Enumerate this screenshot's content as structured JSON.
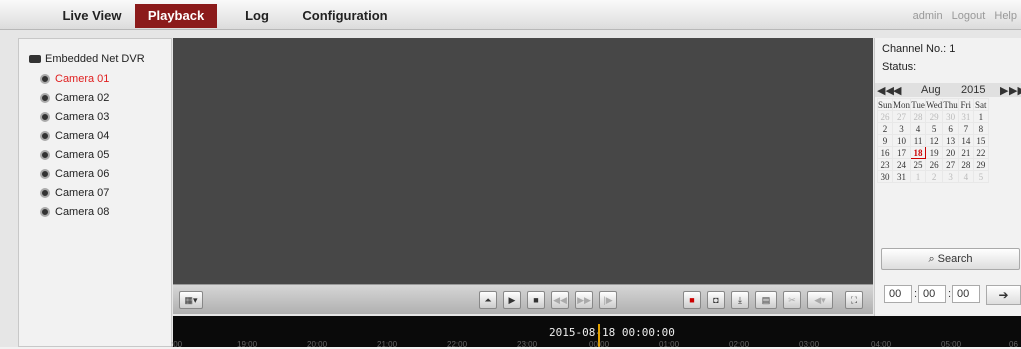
{
  "nav": {
    "tabs": [
      "Live View",
      "Playback",
      "Log",
      "Configuration"
    ],
    "active": "Playback"
  },
  "user": {
    "name": "admin",
    "logout": "Logout",
    "help": "Help"
  },
  "tree": {
    "root": "Embedded Net DVR",
    "cameras": [
      "Camera 01",
      "Camera 02",
      "Camera 03",
      "Camera 04",
      "Camera 05",
      "Camera 06",
      "Camera 07",
      "Camera 08"
    ],
    "selected": "Camera 01"
  },
  "info": {
    "channel_label": "Channel No.: 1",
    "status_label": "Status:"
  },
  "calendar": {
    "month": "Aug",
    "year": "2015",
    "weekdays": [
      "Sun",
      "Mon",
      "Tue",
      "Wed",
      "Thu",
      "Fri",
      "Sat"
    ],
    "weeks": [
      [
        "26",
        "27",
        "28",
        "29",
        "30",
        "31",
        "1"
      ],
      [
        "2",
        "3",
        "4",
        "5",
        "6",
        "7",
        "8"
      ],
      [
        "9",
        "10",
        "11",
        "12",
        "13",
        "14",
        "15"
      ],
      [
        "16",
        "17",
        "18",
        "19",
        "20",
        "21",
        "22"
      ],
      [
        "23",
        "24",
        "25",
        "26",
        "27",
        "28",
        "29"
      ],
      [
        "30",
        "31",
        "1",
        "2",
        "3",
        "4",
        "5"
      ]
    ],
    "today": "18"
  },
  "search_label": "Search",
  "time_fields": {
    "hh": "00",
    "mm": "00",
    "ss": "00"
  },
  "timeline": {
    "current": "2015-08-18 00:00:00",
    "ticks": [
      ":00",
      "19:00",
      "20:00",
      "21:00",
      "22:00",
      "23:00",
      "00:00",
      "01:00",
      "02:00",
      "03:00",
      "04:00",
      "05:00",
      "06"
    ]
  },
  "colors": {
    "accent": "#8b1a1a",
    "selected_camera": "#e02020",
    "today_border": "#cc0000"
  }
}
